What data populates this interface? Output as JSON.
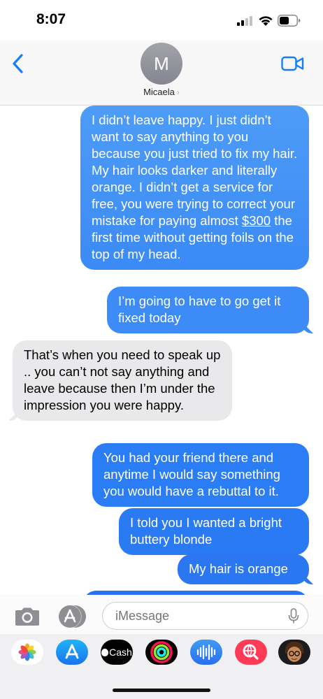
{
  "status_bar": {
    "time": "8:07"
  },
  "header": {
    "avatar_initial": "M",
    "contact_name": "Micaela",
    "chevron": "›"
  },
  "messages": [
    {
      "type": "sent",
      "pre": "I didn’t leave happy. I just didn’t want to say anything to you because you just tried to fix my hair. My hair looks darker and literally orange. I didn’t get a service for free, you were trying to correct your mistake for paying almost ",
      "link": "$300",
      "post": " the first time without getting foils on the top of my head."
    },
    {
      "type": "sent",
      "text": "I’m going to have to go get it fixed today"
    },
    {
      "type": "received",
      "text": "That’s when you need to speak up .. you can’t not say anything and leave because then I’m under the impression you were happy."
    },
    {
      "type": "sent",
      "text": "You had your friend there and anytime I would say something you would have a rebuttal to it."
    },
    {
      "type": "sent",
      "text": "I told you I wanted a bright buttery blonde"
    },
    {
      "type": "sent",
      "text": "My hair is orange"
    }
  ],
  "input": {
    "placeholder": "iMessage"
  },
  "apps": [
    {
      "name": "photos-app-icon"
    },
    {
      "name": "app-store-app-icon"
    },
    {
      "name": "apple-cash-app-icon",
      "label": "Cash"
    },
    {
      "name": "activity-app-icon"
    },
    {
      "name": "audio-message-app-icon"
    },
    {
      "name": "images-search-app-icon"
    },
    {
      "name": "memoji-app-icon"
    }
  ],
  "colors": {
    "sent_bubble": "#1b84fb",
    "received_bubble": "#e9e9eb",
    "accent": "#157efb"
  }
}
